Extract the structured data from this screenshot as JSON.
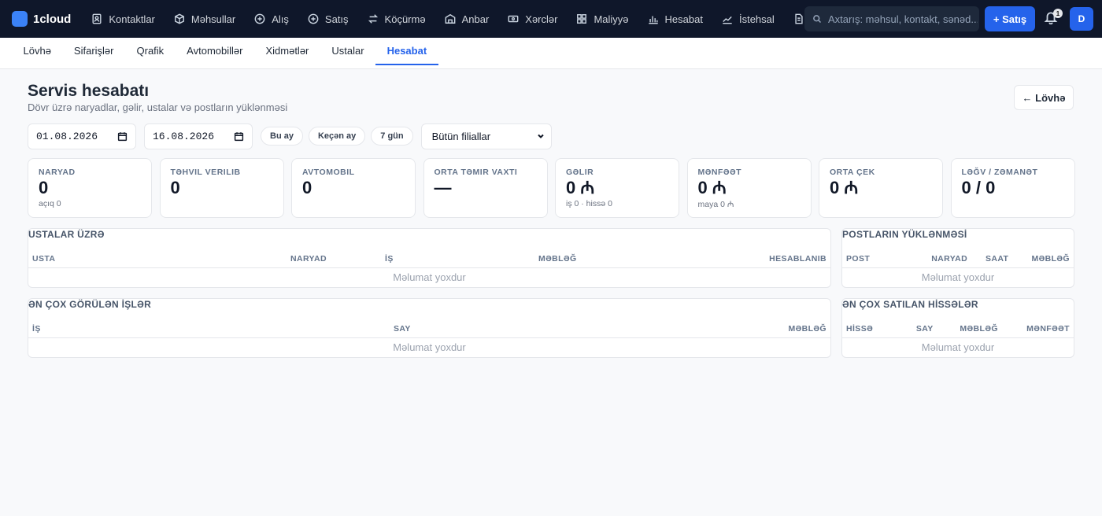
{
  "app": {
    "name": "1cloud"
  },
  "nav": [
    {
      "label": "Kontaktlar",
      "icon": "contacts-icon"
    },
    {
      "label": "Məhsullar",
      "icon": "box-icon"
    },
    {
      "label": "Alış",
      "icon": "plus-circle-icon"
    },
    {
      "label": "Satış",
      "icon": "plus-circle-icon"
    },
    {
      "label": "Köçürmə",
      "icon": "transfer-icon"
    },
    {
      "label": "Anbar",
      "icon": "warehouse-icon"
    },
    {
      "label": "Xərclər",
      "icon": "money-icon"
    },
    {
      "label": "Maliyyə",
      "icon": "grid-icon"
    },
    {
      "label": "Hesabat",
      "icon": "bar-chart-icon"
    },
    {
      "label": "İstehsal",
      "icon": "factory-icon"
    }
  ],
  "search": {
    "placeholder": "Axtarış: məhsul, kontakt, sənəd..."
  },
  "header": {
    "new_sale_label": "+ Satış",
    "notification_count": "1",
    "avatar_initial": "D"
  },
  "subtabs": [
    {
      "label": "Lövhə",
      "active": false
    },
    {
      "label": "Sifarişlər",
      "active": false
    },
    {
      "label": "Qrafik",
      "active": false
    },
    {
      "label": "Avtomobillər",
      "active": false
    },
    {
      "label": "Xidmətlər",
      "active": false
    },
    {
      "label": "Ustalar",
      "active": false
    },
    {
      "label": "Hesabat",
      "active": true
    }
  ],
  "page": {
    "title": "Servis hesabatı",
    "subtitle": "Dövr üzrə naryadlar, gəlir, ustalar və postların yüklənməsi",
    "back_label": "← Lövhə"
  },
  "filters": {
    "date_from": "01.08.2026",
    "date_to": "16.08.2026",
    "presets": [
      "Bu ay",
      "Keçən ay",
      "7 gün"
    ],
    "branch": "Bütün filiallar"
  },
  "kpis": [
    {
      "label": "Naryad",
      "value": "0",
      "sub": "açıq 0"
    },
    {
      "label": "Təhvil verilib",
      "value": "0",
      "sub": ""
    },
    {
      "label": "Avtomobil",
      "value": "0",
      "sub": ""
    },
    {
      "label": "Orta təmir vaxtı",
      "value": "—",
      "sub": ""
    },
    {
      "label": "Gəlir",
      "value": "0 ₼",
      "sub": "iş 0 · hissə 0"
    },
    {
      "label": "Mənfəət",
      "value": "0 ₼",
      "sub": "maya 0 ₼"
    },
    {
      "label": "Orta çek",
      "value": "0 ₼",
      "sub": ""
    },
    {
      "label": "Ləğv / zəmanət",
      "value": "0 / 0",
      "sub": ""
    }
  ],
  "tables": {
    "masters": {
      "title": "USTALAR ÜZRƏ",
      "columns": [
        "USTA",
        "NARYAD",
        "İŞ",
        "MƏBLƏĞ",
        "HESABLANIB"
      ],
      "empty": "Məlumat yoxdur"
    },
    "posts": {
      "title": "POSTLARIN YÜKLƏNMƏSİ",
      "columns": [
        "POST",
        "NARYAD",
        "SAAT",
        "MƏBLƏĞ"
      ],
      "empty": "Məlumat yoxdur"
    },
    "top_jobs": {
      "title": "ƏN ÇOX GÖRÜLƏN İŞLƏR",
      "columns": [
        "İŞ",
        "SAY",
        "MƏBLƏĞ"
      ],
      "empty": "Məlumat yoxdur"
    },
    "top_parts": {
      "title": "ƏN ÇOX SATILAN HİSSƏLƏR",
      "columns": [
        "HİSSƏ",
        "SAY",
        "MƏBLƏĞ",
        "MƏNFƏƏT"
      ],
      "empty": "Məlumat yoxdur"
    }
  },
  "colors": {
    "navbar": "#0f172a",
    "accent": "#2563eb",
    "background": "#f8f9fb"
  }
}
